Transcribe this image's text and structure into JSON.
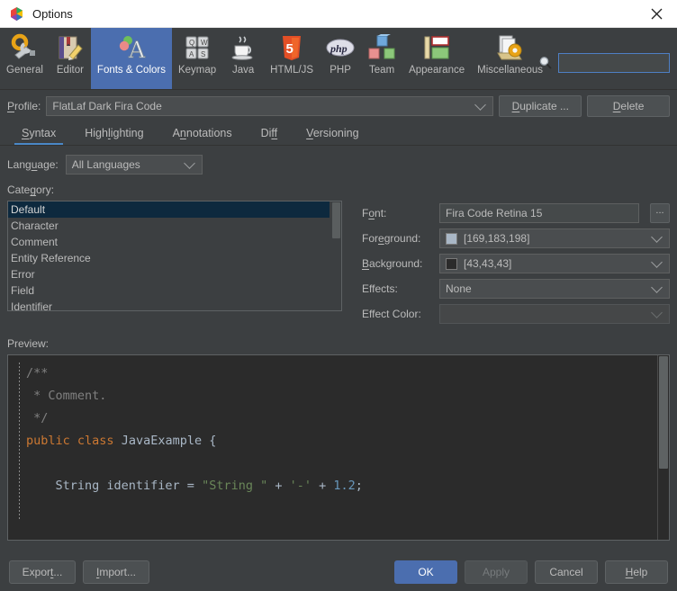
{
  "window": {
    "title": "Options",
    "app_icon": "cube-logo-icon",
    "close_icon": "close-icon"
  },
  "toolbar": {
    "items": [
      {
        "label": "General",
        "icon": "gear-wrench-icon",
        "selected": false
      },
      {
        "label": "Editor",
        "icon": "notebook-pencil-icon",
        "selected": false
      },
      {
        "label": "Fonts & Colors",
        "icon": "font-colors-icon",
        "selected": true
      },
      {
        "label": "Keymap",
        "icon": "keyboard-keys-icon",
        "selected": false
      },
      {
        "label": "Java",
        "icon": "coffee-cup-icon",
        "selected": false
      },
      {
        "label": "HTML/JS",
        "icon": "html5-shield-icon",
        "selected": false
      },
      {
        "label": "PHP",
        "icon": "php-elephant-icon",
        "selected": false
      },
      {
        "label": "Team",
        "icon": "blocks-icon",
        "selected": false
      },
      {
        "label": "Appearance",
        "icon": "layout-panels-icon",
        "selected": false
      },
      {
        "label": "Miscellaneous",
        "icon": "documents-gear-icon",
        "selected": false
      }
    ],
    "search": {
      "icon": "magnifier-icon",
      "value": "",
      "placeholder": ""
    }
  },
  "profile": {
    "label": "Profile:",
    "label_mnemonic": "P",
    "value": "FlatLaf Dark Fira Code",
    "chevron_icon": "chevron-down-icon",
    "duplicate_button": "Duplicate ...",
    "duplicate_mnemonic": "D",
    "delete_button": "Delete",
    "delete_mnemonic": "D"
  },
  "tabs": [
    {
      "label": "Syntax",
      "mnemonic": "S",
      "selected": true
    },
    {
      "label": "Highlighting",
      "mnemonic": "l",
      "selected": false
    },
    {
      "label": "Annotations",
      "mnemonic": "n",
      "selected": false
    },
    {
      "label": "Diff",
      "mnemonic": "ff",
      "selected": false
    },
    {
      "label": "Versioning",
      "mnemonic": "V",
      "selected": false
    }
  ],
  "language": {
    "label": "Language:",
    "value": "All Languages",
    "chevron_icon": "chevron-down-icon"
  },
  "category": {
    "label": "Category:",
    "items": [
      {
        "label": "Default",
        "selected": true
      },
      {
        "label": "Character",
        "selected": false
      },
      {
        "label": "Comment",
        "selected": false
      },
      {
        "label": "Entity Reference",
        "selected": false
      },
      {
        "label": "Error",
        "selected": false
      },
      {
        "label": "Field",
        "selected": false
      },
      {
        "label": "Identifier",
        "selected": false
      }
    ]
  },
  "properties": {
    "font": {
      "label": "Font:",
      "value": "Fira Code Retina 15",
      "browse_button": "..."
    },
    "foreground": {
      "label": "Foreground:",
      "value": "[169,183,198]",
      "swatch_color": "#A9B7C6",
      "chevron_icon": "chevron-down-icon"
    },
    "background": {
      "label": "Background:",
      "value": "[43,43,43]",
      "swatch_color": "#2B2B2B",
      "chevron_icon": "chevron-down-icon"
    },
    "effects": {
      "label": "Effects:",
      "value": "None",
      "chevron_icon": "chevron-down-icon"
    },
    "effect_color": {
      "label": "Effect Color:",
      "value": "",
      "chevron_icon": "chevron-down-icon"
    }
  },
  "preview": {
    "label": "Preview:",
    "lines": [
      {
        "tokens": [
          {
            "t": "/**",
            "c": "cmt"
          }
        ]
      },
      {
        "tokens": [
          {
            "t": " * Comment.",
            "c": "cmt"
          }
        ]
      },
      {
        "tokens": [
          {
            "t": " */",
            "c": "cmt"
          }
        ]
      },
      {
        "tokens": [
          {
            "t": "public",
            "c": "kw"
          },
          {
            "t": " ",
            "c": "pln"
          },
          {
            "t": "class",
            "c": "kw"
          },
          {
            "t": " ",
            "c": "pln"
          },
          {
            "t": "JavaExample",
            "c": "cls"
          },
          {
            "t": " {",
            "c": "pln"
          }
        ]
      },
      {
        "tokens": [
          {
            "t": "",
            "c": "pln"
          }
        ]
      },
      {
        "tokens": [
          {
            "t": "    String identifier = ",
            "c": "pln"
          },
          {
            "t": "\"String \"",
            "c": "str"
          },
          {
            "t": " + ",
            "c": "pln"
          },
          {
            "t": "'-'",
            "c": "chr"
          },
          {
            "t": " + ",
            "c": "pln"
          },
          {
            "t": "1.2",
            "c": "num"
          },
          {
            "t": ";",
            "c": "pln"
          }
        ]
      }
    ]
  },
  "footer": {
    "export_button": "Export...",
    "export_mnemonic": "t",
    "import_button": "Import...",
    "import_mnemonic": "I",
    "ok_button": "OK",
    "apply_button": "Apply",
    "cancel_button": "Cancel",
    "help_button": "Help",
    "help_mnemonic": "H"
  },
  "colors": {
    "accent_blue": "#4B6EAF",
    "tab_underline": "#4A88C7",
    "window_bg": "#3C3F41",
    "editor_bg": "#2B2B2B",
    "text": "#BBBBBB",
    "list_selection": "#0D293E"
  }
}
